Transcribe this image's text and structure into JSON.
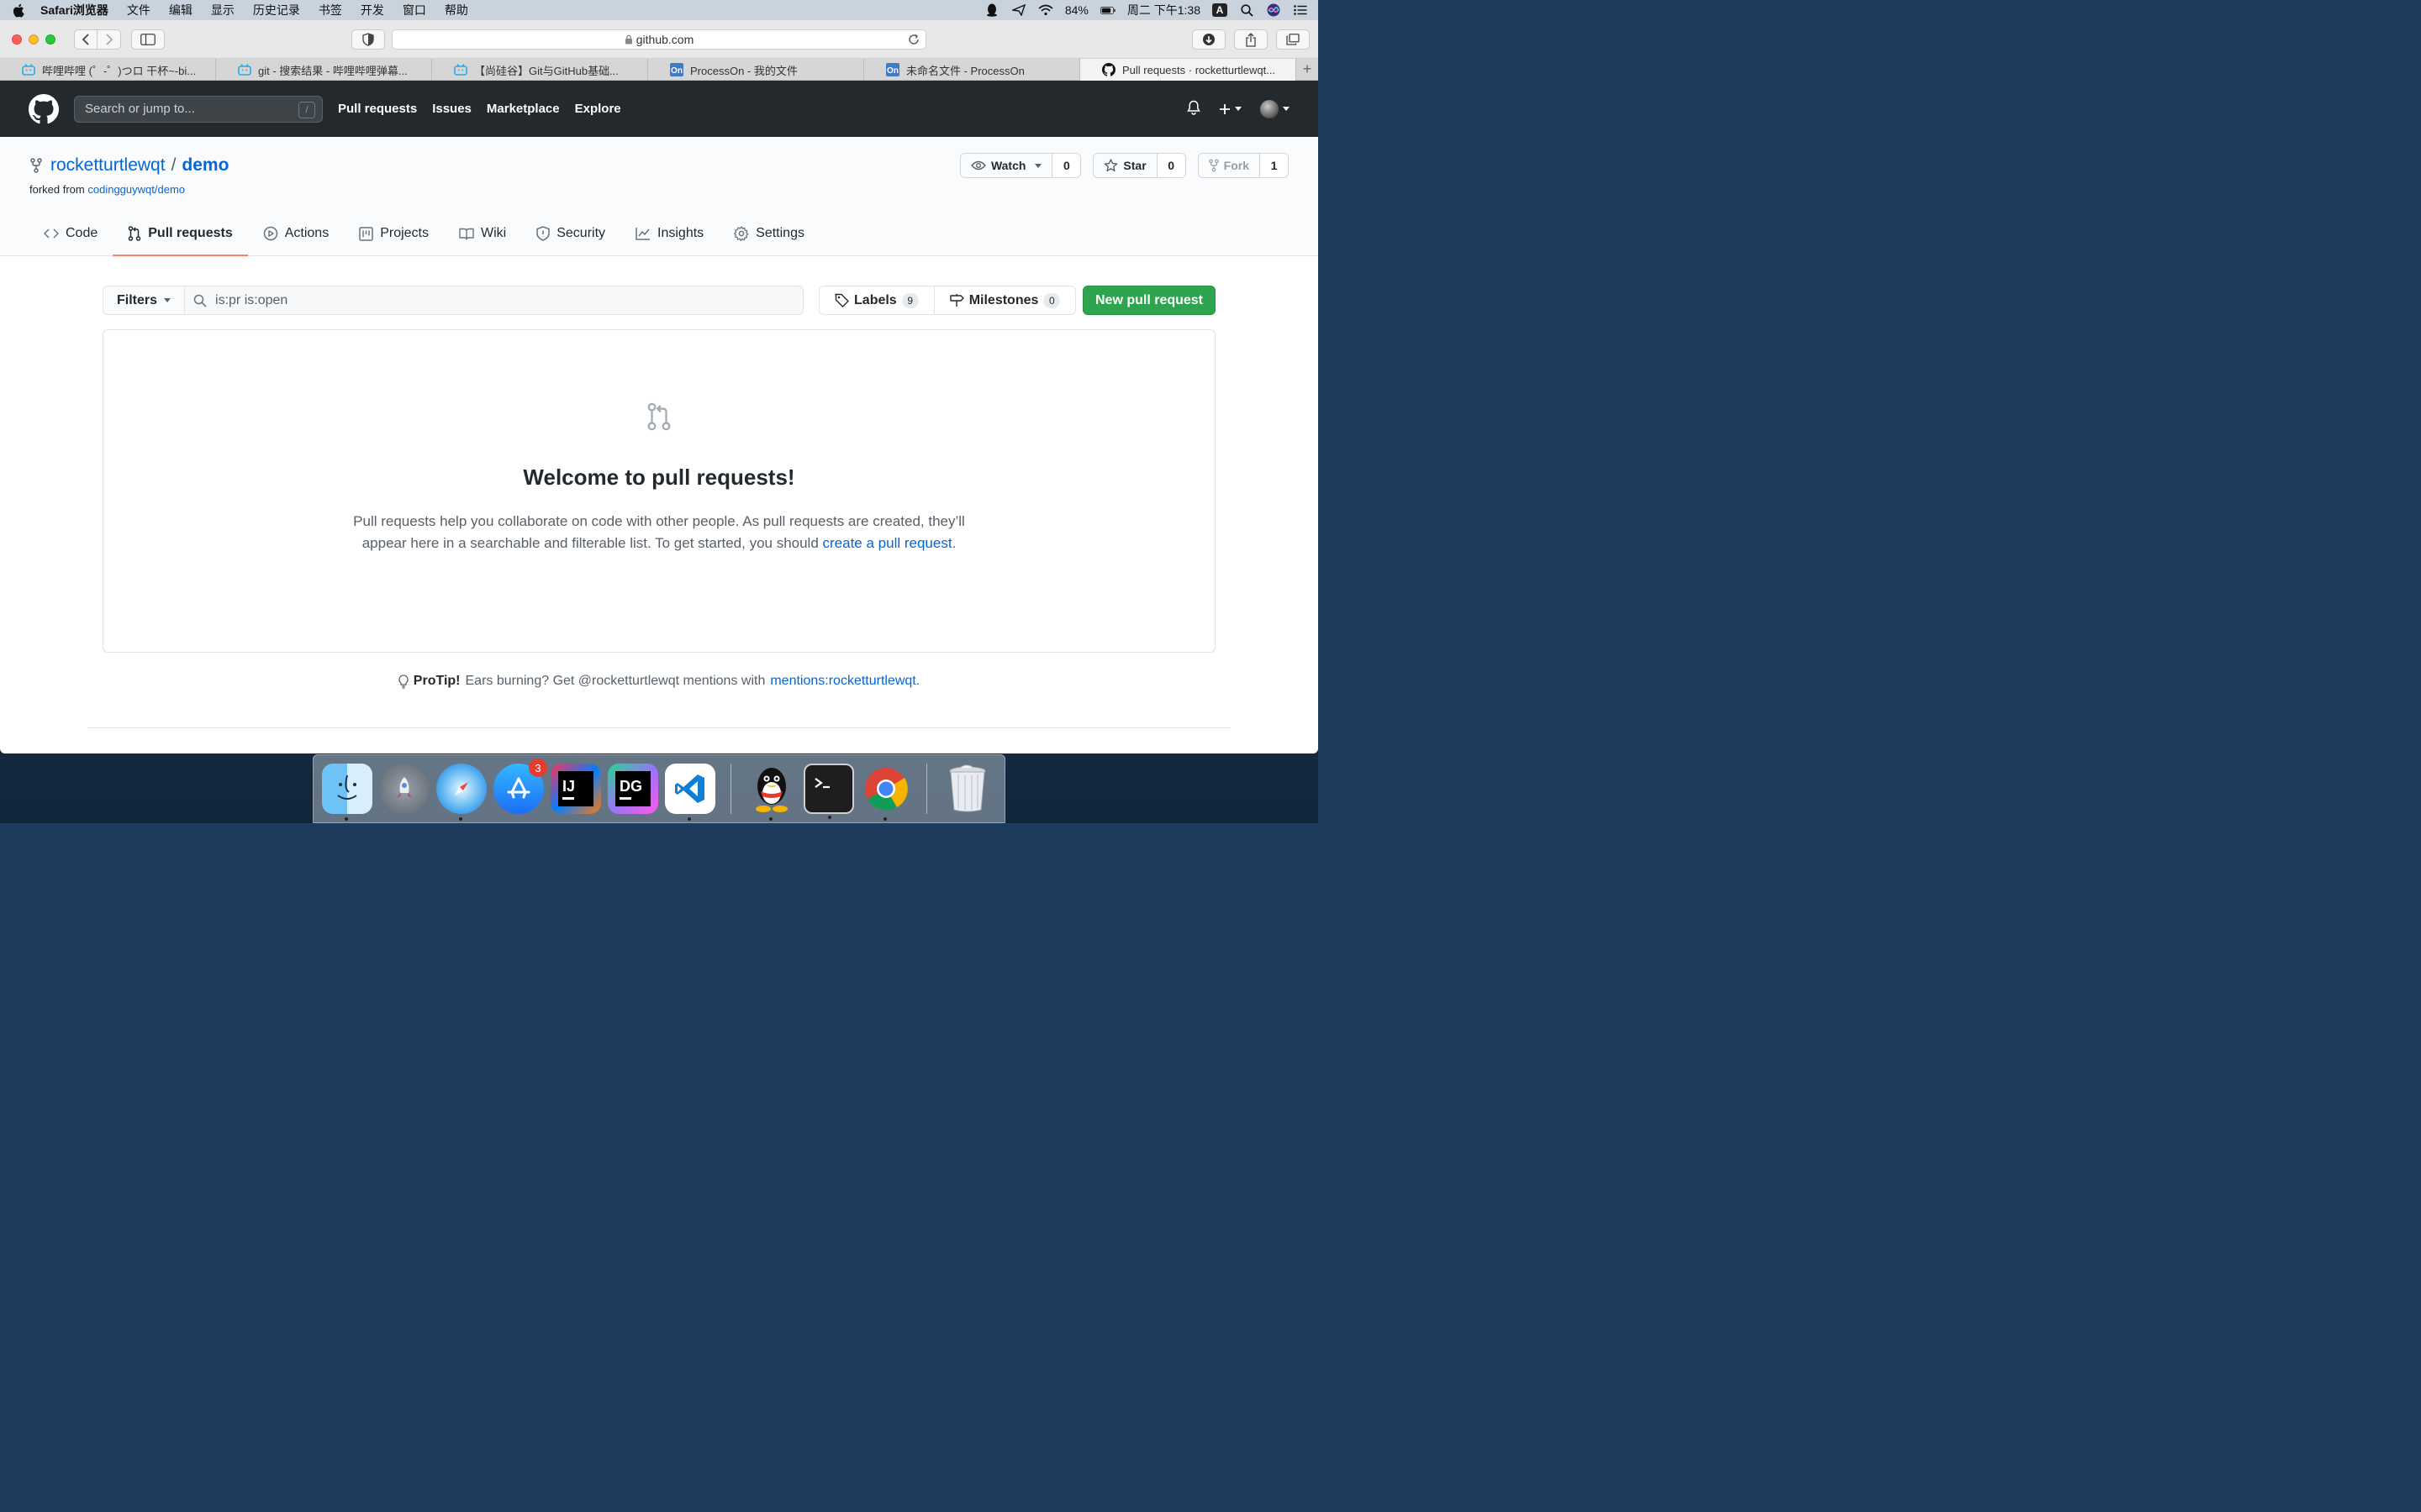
{
  "menubar": {
    "app_name": "Safari浏览器",
    "items": [
      "文件",
      "编辑",
      "显示",
      "历史记录",
      "书签",
      "开发",
      "窗口",
      "帮助"
    ],
    "battery": "84%",
    "clock": "周二 下午1:38",
    "input_method": "A"
  },
  "browser": {
    "url": "github.com",
    "tabs": [
      {
        "label": "哔哩哔哩 (゜-゜)つロ 干杯~-bi...",
        "icon": "bilibili-icon"
      },
      {
        "label": "git - 搜索结果 - 哔哩哔哩弹幕...",
        "icon": "bilibili-icon"
      },
      {
        "label": "【尚硅谷】Git与GitHub基础...",
        "icon": "bilibili-icon"
      },
      {
        "label": "ProcessOn - 我的文件",
        "icon": "processon-icon"
      },
      {
        "label": "未命名文件 - ProcessOn",
        "icon": "processon-icon"
      },
      {
        "label": "Pull requests · rocketturtlewqt...",
        "icon": "github-icon"
      }
    ],
    "active_tab": 5
  },
  "github": {
    "search_placeholder": "Search or jump to...",
    "search_shortcut": "/",
    "nav": [
      "Pull requests",
      "Issues",
      "Marketplace",
      "Explore"
    ]
  },
  "repo": {
    "owner": "rocketturtlewqt",
    "separator": "/",
    "name": "demo",
    "forked_prefix": "forked from",
    "forked_source": "codingguywqt/demo",
    "watch": {
      "label": "Watch",
      "count": "0"
    },
    "star": {
      "label": "Star",
      "count": "0"
    },
    "fork": {
      "label": "Fork",
      "count": "1"
    },
    "tabs": [
      {
        "label": "Code",
        "icon": "code-icon"
      },
      {
        "label": "Pull requests",
        "icon": "git-pull-request-icon",
        "selected": true
      },
      {
        "label": "Actions",
        "icon": "play-icon"
      },
      {
        "label": "Projects",
        "icon": "project-icon"
      },
      {
        "label": "Wiki",
        "icon": "book-icon"
      },
      {
        "label": "Security",
        "icon": "shield-icon"
      },
      {
        "label": "Insights",
        "icon": "graph-icon"
      },
      {
        "label": "Settings",
        "icon": "gear-icon"
      }
    ]
  },
  "pulls": {
    "filters_label": "Filters",
    "search_value": "is:pr is:open",
    "labels": {
      "label": "Labels",
      "count": "9"
    },
    "milestones": {
      "label": "Milestones",
      "count": "0"
    },
    "new_button": "New pull request",
    "blank_title": "Welcome to pull requests!",
    "blank_text": "Pull requests help you collaborate on code with other people. As pull requests are created, they’ll appear here in a searchable and filterable list. To get started, you should ",
    "blank_link": "create a pull request",
    "blank_end": ".",
    "protip_label": "ProTip!",
    "protip_text": "Ears burning? Get @rocketturtlewqt mentions with",
    "protip_link": "mentions:rocketturtlewqt",
    "protip_end": "."
  },
  "dock": {
    "apps": [
      "finder-icon",
      "launchpad-icon",
      "safari-icon",
      "app-store-icon",
      "intellij-icon",
      "datagrip-icon",
      "vscode-icon",
      "qq-icon",
      "terminal-icon",
      "chrome-icon",
      "trash-icon"
    ],
    "app_store_badge": "3",
    "intellij_text": "IJ",
    "datagrip_text": "DG"
  }
}
